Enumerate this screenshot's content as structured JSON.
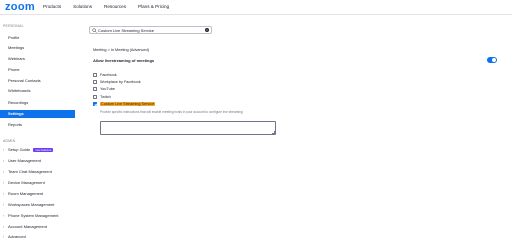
{
  "brand": {
    "logo": "zoom",
    "color": "#0e72ed"
  },
  "topnav": [
    "Products",
    "Solutions",
    "Resources",
    "Plans & Pricing"
  ],
  "sidebar": {
    "personal_heading": "PERSONAL",
    "personal_items": [
      "Profile",
      "Meetings",
      "Webinars",
      "Phone",
      "Personal Contacts",
      "Whiteboards",
      "Recordings",
      "Settings",
      "Reports"
    ],
    "active_item": "Settings",
    "admin_heading": "ADMIN",
    "admin_items": [
      "Setup Guide",
      "User Management",
      "Team Chat Management",
      "Device Management",
      "Room Management",
      "Workspaces Management",
      "Phone System Management",
      "Account Management",
      "Advanced"
    ],
    "setup_badge": "new features"
  },
  "search": {
    "value": "Custom Live Streaming Service",
    "icon": "search-icon",
    "clear_icon": "clear-icon"
  },
  "breadcrumb": "Meeting > In Meeting (Advanced)",
  "setting": {
    "title": "Allow livestreaming of meetings",
    "enabled": true,
    "options": [
      {
        "label": "Facebook",
        "checked": false
      },
      {
        "label": "Workplace by Facebook",
        "checked": false
      },
      {
        "label": "YouTube",
        "checked": false
      },
      {
        "label": "Twitch",
        "checked": false
      },
      {
        "label": "Custom Live Streaming Service",
        "checked": true,
        "highlighted": true
      }
    ],
    "helper": "Provide specific instructions that will enable meeting hosts in your account to configure live streaming",
    "textarea_value": ""
  }
}
